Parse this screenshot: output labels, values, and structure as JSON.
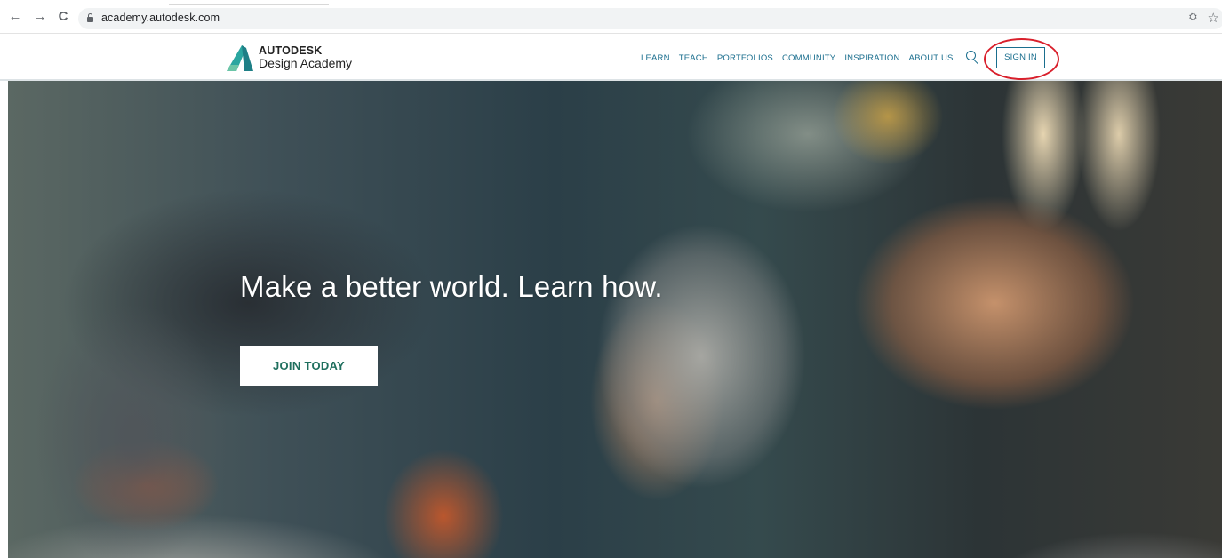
{
  "browser": {
    "back_icon": "←",
    "forward_icon": "→",
    "reload_icon": "C",
    "url": "academy.autodesk.com",
    "translate_icon": "⛭",
    "star_icon": "☆"
  },
  "header": {
    "logo_brand": "AUTODESK",
    "logo_product": "Design Academy",
    "nav": [
      "LEARN",
      "TEACH",
      "PORTFOLIOS",
      "COMMUNITY",
      "INSPIRATION",
      "ABOUT US"
    ],
    "sign_in_label": "SIGN IN",
    "accent_color": "#1a6e8e"
  },
  "hero": {
    "title": "Make a better world. Learn how.",
    "cta_label": "JOIN TODAY"
  },
  "annotation": {
    "color": "#d9202c"
  }
}
